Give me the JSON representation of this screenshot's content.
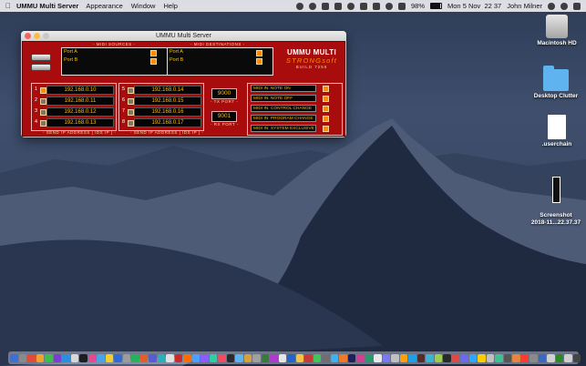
{
  "menubar": {
    "app_name": "UMMU Multi Server",
    "menus": [
      "Appearance",
      "Window",
      "Help"
    ],
    "battery": "98%",
    "datetime": "Mon 5 Nov  22 37",
    "user": "John Milner"
  },
  "window": {
    "title": "UMMU Multi Server",
    "midi_sources_label": "- MIDI SOURCES -",
    "midi_destinations_label": "- MIDI DESTINATIONS -",
    "sources": [
      {
        "label": "Port A",
        "checked": true
      },
      {
        "label": "Port B",
        "checked": true
      }
    ],
    "destinations": [
      {
        "label": "Port A",
        "checked": true
      },
      {
        "label": "Port B",
        "checked": true
      }
    ],
    "brand": {
      "line1": "UMMU MULTI",
      "line2": "STRONGsoft",
      "line3": "BUILD 7250"
    },
    "ip_group_1": [
      {
        "num": "1",
        "ip": "192.168.0.10",
        "checked": true
      },
      {
        "num": "2",
        "ip": "192.168.0.11",
        "checked": false
      },
      {
        "num": "3",
        "ip": "192.168.0.12",
        "checked": false
      },
      {
        "num": "4",
        "ip": "192.168.0.13",
        "checked": false
      }
    ],
    "ip_group_2": [
      {
        "num": "5",
        "ip": "192.168.0.14",
        "checked": false
      },
      {
        "num": "6",
        "ip": "192.168.0.15",
        "checked": false
      },
      {
        "num": "7",
        "ip": "192.168.0.16",
        "checked": false
      },
      {
        "num": "8",
        "ip": "192.168.0.17",
        "checked": false
      }
    ],
    "send_ip_label_1": "- SEND IP ADDRESS [ IDS IP ] -",
    "send_ip_label_2": "- SEND IP ADDRESS [ IDS IP ] -",
    "tx_port": {
      "value": "9000",
      "label": "- TX PORT -"
    },
    "rx_port": {
      "value": "9001",
      "label": "- RX PORT -"
    },
    "midi_filters": [
      {
        "label": "MIDI IN: NOTE ON",
        "checked": true
      },
      {
        "label": "MIDI IN: NOTE OFF",
        "checked": true
      },
      {
        "label": "MIDI IN: CONTROL CHANGE",
        "checked": true
      },
      {
        "label": "MIDI IN: PROGRAM CHANGE",
        "checked": true
      },
      {
        "label": "MIDI IN: SYSTEM EXCLUSIVE",
        "checked": true
      }
    ]
  },
  "desktop": {
    "icons": [
      {
        "label": "Macintosh HD",
        "kind": "hdd-icon"
      },
      {
        "label": "Desktop Clutter",
        "kind": "folder-icon"
      },
      {
        "label": ".userchain",
        "kind": "document-icon"
      },
      {
        "label": "Screenshot\n2018-11...22.37.37",
        "kind": "screenshot-icon"
      }
    ]
  },
  "dock_colors": [
    "#3c6fd8",
    "#8a8a8a",
    "#e14c3a",
    "#f2a22c",
    "#3cbf4a",
    "#7a3fd0",
    "#2a8fe0",
    "#d8d8d8",
    "#1e1e1e",
    "#e44b8f",
    "#47a4e8",
    "#f0d030",
    "#2f6bd8",
    "#9c9c9c",
    "#26b25a",
    "#e85b2a",
    "#5a5ad8",
    "#2ab0b8",
    "#e0e0e0",
    "#cc2b2b",
    "#ff6d00",
    "#4ca0ff",
    "#8d5cff",
    "#2ed0a0",
    "#f04e60",
    "#2b2b2b",
    "#5fb3ee",
    "#d8a03a",
    "#a0a0a0",
    "#3a7a3a",
    "#b03ad0",
    "#e6e6e6",
    "#1f66cc",
    "#f6c244",
    "#c83a3a",
    "#41c65a",
    "#6f6f6f",
    "#3fb0f0",
    "#ee7a28",
    "#202060",
    "#d04090",
    "#2a9a6a",
    "#e8e8e8",
    "#7a7af0",
    "#c0c0c0",
    "#ff9f0a",
    "#1ea0e8",
    "#5a2a2a",
    "#36b6d0",
    "#9bd04a",
    "#2a2a2a",
    "#e04848",
    "#6a6af0",
    "#2fa6ff",
    "#ffcc00",
    "#c0c0c0",
    "#40c090",
    "#555555",
    "#e8853a",
    "#ff3b30",
    "#8a8a8a",
    "#3a6ac0",
    "#d0d0d0",
    "#2a8a2a",
    "#cfcfcf",
    "#444444"
  ]
}
